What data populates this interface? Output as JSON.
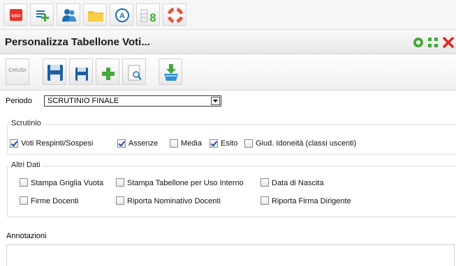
{
  "top_toolbar": {
    "buttons": [
      {
        "name": "esci",
        "label": "ESCI",
        "icon": "exit-icon"
      },
      {
        "name": "add-list",
        "icon": "add-list-icon"
      },
      {
        "name": "users",
        "icon": "users-icon"
      },
      {
        "name": "folder",
        "icon": "folder-icon"
      },
      {
        "name": "a-circle",
        "label": "A",
        "icon": "a-circle-icon"
      },
      {
        "name": "grade-8",
        "label": "8",
        "icon": "grade-8-icon"
      },
      {
        "name": "help",
        "icon": "lifebuoy-icon"
      }
    ]
  },
  "window": {
    "title": "Personalizza Tabellone Voti...",
    "controls": [
      "refresh-icon",
      "maximize-icon",
      "close-icon"
    ]
  },
  "action_toolbar": {
    "chiudi_label": "CHIUDI",
    "buttons": [
      "save-icon",
      "save-small-icon",
      "add-icon",
      "preview-icon",
      "download-icon"
    ]
  },
  "form": {
    "periodo_label": "Periodo",
    "periodo_value": "SCRUTINIO FINALE",
    "scrutinio": {
      "legend": "Scrutinio",
      "options": [
        {
          "label": "Voti Respinti/Sospesi",
          "checked": true
        },
        {
          "label": "Assenze",
          "checked": true
        },
        {
          "label": "Media",
          "checked": false
        },
        {
          "label": "Esito",
          "checked": true
        },
        {
          "label": "Giud. Idoneità (classi uscenti)",
          "checked": false
        }
      ]
    },
    "altri_dati": {
      "legend": "Altri Dati",
      "options": [
        {
          "label": "Stampa Griglia Vuota",
          "checked": false
        },
        {
          "label": "Stampa Tabellone per Uso Interno",
          "checked": false
        },
        {
          "label": "Data di Nascita",
          "checked": false
        },
        {
          "label": "Firme Docenti",
          "checked": false
        },
        {
          "label": "Riporta Nominativo Docenti",
          "checked": false
        },
        {
          "label": "Riporta Firma Dirigente",
          "checked": false
        }
      ]
    },
    "annotazioni_label": "Annotazioni",
    "annotazioni_value": ""
  },
  "colors": {
    "esci_red": "#e8332a",
    "icon_blue": "#1f6fb0",
    "icon_green": "#44a83a",
    "close_red": "#e0261c",
    "check_blue": "#1c4fa8"
  }
}
